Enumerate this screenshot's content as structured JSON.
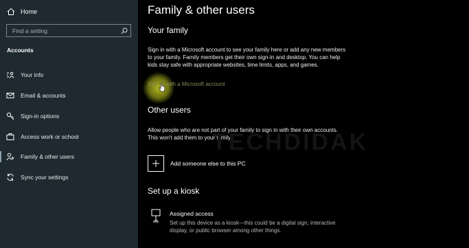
{
  "sidebar": {
    "home_label": "Home",
    "search_placeholder": "Find a setting",
    "section_title": "Accounts",
    "items": [
      {
        "label": "Your info",
        "icon": "person-card-icon"
      },
      {
        "label": "Email & accounts",
        "icon": "email-icon"
      },
      {
        "label": "Sign-in options",
        "icon": "key-icon"
      },
      {
        "label": "Access work or school",
        "icon": "briefcase-icon"
      },
      {
        "label": "Family & other users",
        "icon": "person-add-icon",
        "active": true
      },
      {
        "label": "Sync your settings",
        "icon": "sync-icon"
      }
    ]
  },
  "main": {
    "title": "Family & other users",
    "family": {
      "heading": "Your family",
      "description": "Sign in with a Microsoft account to see your family here or add any new members to your family. Family members get their own sign-in and desktop. You can help kids stay safe with appropriate websites, time limits, apps, and games.",
      "link": "Sign in with a Microsoft account"
    },
    "other_users": {
      "heading": "Other users",
      "description": "Allow people who are not part of your family to sign in with their own accounts. This won't add them to your family.",
      "add_label": "Add someone else to this PC"
    },
    "watermark": "TECHDIDAK",
    "kiosk": {
      "heading": "Set up a kiosk",
      "item_title": "Assigned access",
      "item_description": "Set up this device as a kiosk—this could be a digital sign, interactive display, or public browser among other things."
    }
  },
  "colors": {
    "sidebar_bg": "#1f2a30",
    "main_bg": "#000000",
    "link": "#8a8d56",
    "highlight": "#d2d728"
  }
}
